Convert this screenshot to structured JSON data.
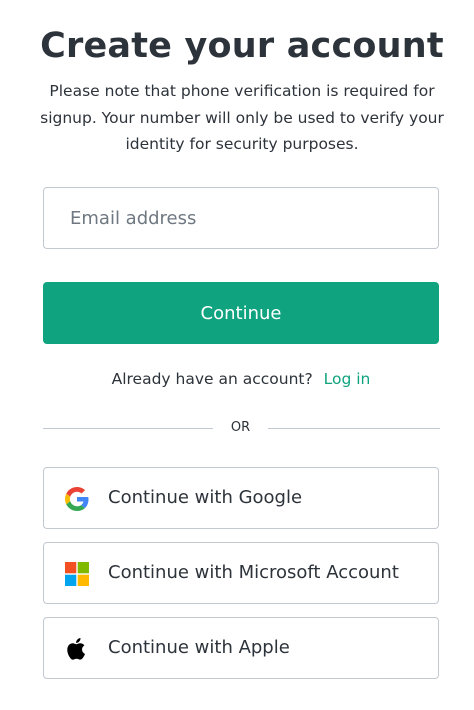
{
  "page": {
    "title": "Create your account",
    "note": "Please note that phone verification is required for signup. Your number will only be used to verify your identity for security purposes."
  },
  "form": {
    "email_placeholder": "Email address",
    "email_value": "",
    "continue_label": "Continue"
  },
  "login": {
    "prompt": "Already have an account?",
    "link_label": "Log in"
  },
  "divider": {
    "text": "OR"
  },
  "social": [
    {
      "label": "Continue with Google",
      "icon": "google-icon"
    },
    {
      "label": "Continue with Microsoft Account",
      "icon": "microsoft-icon"
    },
    {
      "label": "Continue with Apple",
      "icon": "apple-icon"
    }
  ],
  "colors": {
    "accent": "#10a37f",
    "text": "#2d333a",
    "border": "#c2c8d0",
    "google_blue": "#4285F4",
    "google_red": "#EA4335",
    "google_yellow": "#FBBC05",
    "google_green": "#34A853",
    "ms_red": "#F25022",
    "ms_green": "#7FBA00",
    "ms_blue": "#00A4EF",
    "ms_yellow": "#FFB900"
  }
}
